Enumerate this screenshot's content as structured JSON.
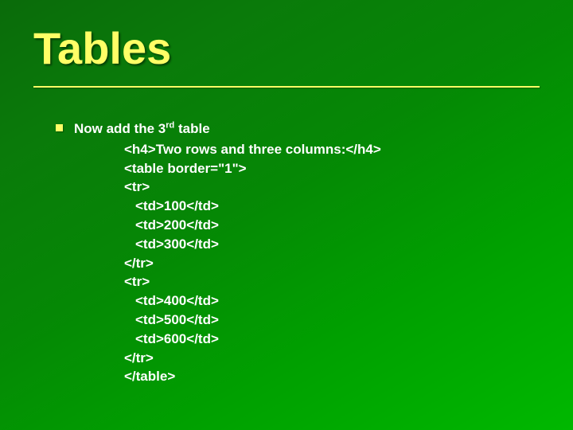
{
  "title": "Tables",
  "bullet": {
    "pre": "Now add the 3",
    "ord": "rd",
    "post": " table"
  },
  "code": {
    "l0": "<h4>Two rows and three columns:</h4>",
    "l1": "<table border=\"1\">",
    "l2": "<tr>",
    "l3": "<td>100</td>",
    "l4": "<td>200</td>",
    "l5": "<td>300</td>",
    "l6": "</tr>",
    "l7": "<tr>",
    "l8": "<td>400</td>",
    "l9": "<td>500</td>",
    "l10": "<td>600</td>",
    "l11": "</tr>",
    "l12": "</table>"
  }
}
